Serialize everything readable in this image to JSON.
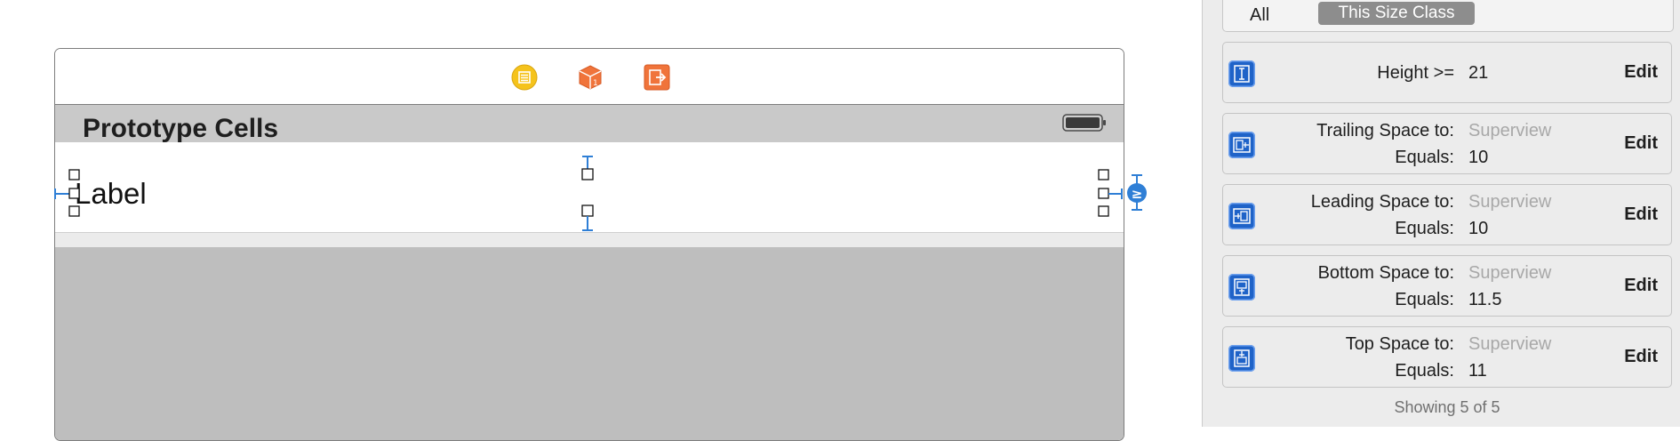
{
  "canvas": {
    "header_title": "Prototype Cells",
    "cell_label": "Label",
    "dock_icons": [
      "view-controller-icon",
      "first-responder-icon",
      "exit-icon"
    ],
    "colors": {
      "dock_vc": "#f5c31c",
      "dock_fr": "#f0743b",
      "dock_exit": "#f0743b",
      "constraint_blue": "#2f7fd6"
    }
  },
  "inspector": {
    "filter": {
      "all": "All",
      "size_class": "This Size Class"
    },
    "constraints": [
      {
        "icon": "height-constraint-icon",
        "label1": "Height >=",
        "value1": "21",
        "label2": "",
        "value2": "",
        "edit": "Edit"
      },
      {
        "icon": "trailing-space-icon",
        "label1": "Trailing Space to:",
        "value1": "Superview",
        "label2": "Equals:",
        "value2": "10",
        "edit": "Edit"
      },
      {
        "icon": "leading-space-icon",
        "label1": "Leading Space to:",
        "value1": "Superview",
        "label2": "Equals:",
        "value2": "10",
        "edit": "Edit"
      },
      {
        "icon": "bottom-space-icon",
        "label1": "Bottom Space to:",
        "value1": "Superview",
        "label2": "Equals:",
        "value2": "11.5",
        "edit": "Edit"
      },
      {
        "icon": "top-space-icon",
        "label1": "Top Space to:",
        "value1": "Superview",
        "label2": "Equals:",
        "value2": "11",
        "edit": "Edit"
      }
    ],
    "footer": "Showing 5 of 5"
  }
}
